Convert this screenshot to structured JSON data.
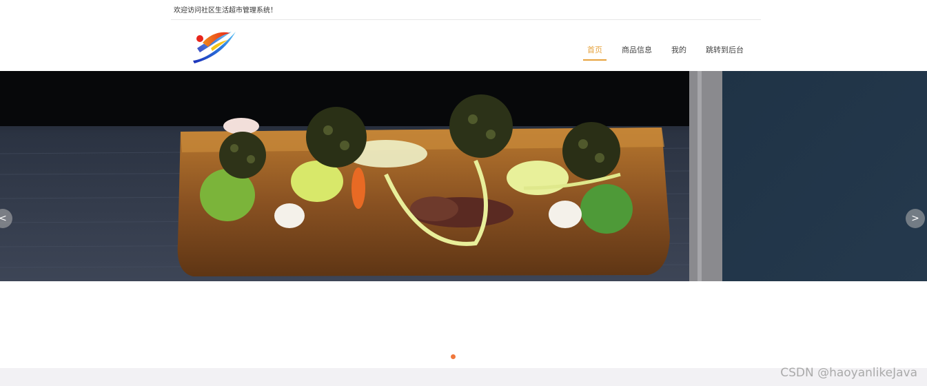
{
  "header": {
    "welcome_text": "欢迎访问社区生活超市管理系统！"
  },
  "nav": {
    "items": [
      {
        "label": "首页",
        "active": true
      },
      {
        "label": "商品信息",
        "active": false
      },
      {
        "label": "我的",
        "active": false
      },
      {
        "label": "跳转到后台",
        "active": false
      }
    ]
  },
  "carousel": {
    "prev_label": "<",
    "next_label": ">",
    "slide_count": 1,
    "active_slide": 1,
    "indicator_color": "#f0783c"
  },
  "watermark": {
    "text": "CSDN @haoyanlikeJava"
  },
  "colors": {
    "accent": "#e6a23c"
  }
}
